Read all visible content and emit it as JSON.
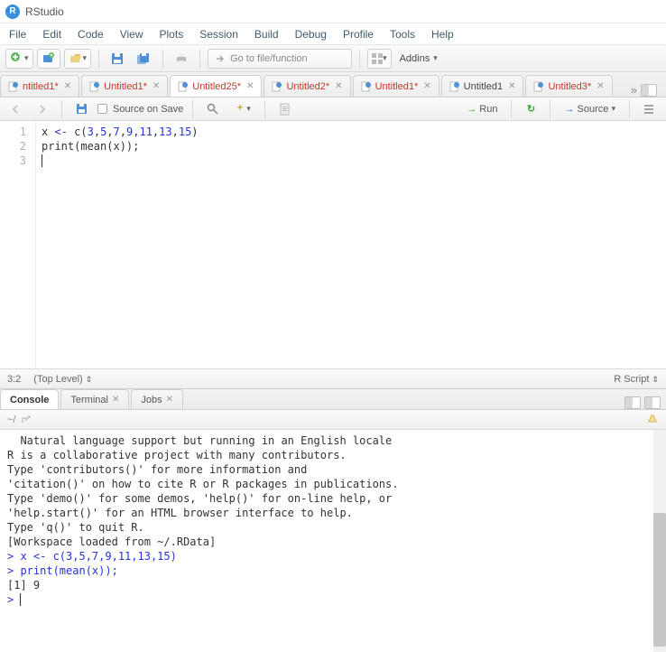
{
  "app": {
    "title": "RStudio",
    "icon_letter": "R"
  },
  "menu": [
    "File",
    "Edit",
    "Code",
    "View",
    "Plots",
    "Session",
    "Build",
    "Debug",
    "Profile",
    "Tools",
    "Help"
  ],
  "main_toolbar": {
    "gotofile_placeholder": "Go to file/function",
    "addins_label": "Addins"
  },
  "tabs": [
    {
      "name": "ntitled1*",
      "modified": true,
      "active": false
    },
    {
      "name": "Untitled1*",
      "modified": true,
      "active": false
    },
    {
      "name": "Untitled25*",
      "modified": true,
      "active": true
    },
    {
      "name": "Untitled2*",
      "modified": true,
      "active": false
    },
    {
      "name": "Untitled1*",
      "modified": true,
      "active": false
    },
    {
      "name": "Untitled1",
      "modified": false,
      "active": false
    },
    {
      "name": "Untitled3*",
      "modified": true,
      "active": false
    }
  ],
  "editor_toolbar": {
    "source_on_save": "Source on Save",
    "run": "Run",
    "source": "Source"
  },
  "editor": {
    "line_numbers": [
      "1",
      "2",
      "3"
    ],
    "lines": [
      "x <- c(3,5,7,9,11,13,15)",
      "print(mean(x));",
      ""
    ]
  },
  "statusbar": {
    "pos": "3:2",
    "scope": "(Top Level)",
    "lang": "R Script"
  },
  "console_tabs": [
    {
      "name": "Console",
      "active": true,
      "closable": false
    },
    {
      "name": "Terminal",
      "active": false,
      "closable": true
    },
    {
      "name": "Jobs",
      "active": false,
      "closable": true
    }
  ],
  "console_path": "~/",
  "console": {
    "pre_lines": [
      "  Natural language support but running in an English locale",
      "",
      "R is a collaborative project with many contributors.",
      "Type 'contributors()' for more information and",
      "'citation()' on how to cite R or R packages in publications.",
      "",
      "Type 'demo()' for some demos, 'help()' for on-line help, or",
      "'help.start()' for an HTML browser interface to help.",
      "Type 'q()' to quit R.",
      "",
      "[Workspace loaded from ~/.RData]",
      ""
    ],
    "cmd_lines": [
      "> x <- c(3,5,7,9,11,13,15)",
      "> print(mean(x));"
    ],
    "out_lines": [
      "[1] 9"
    ],
    "prompt": "> "
  }
}
